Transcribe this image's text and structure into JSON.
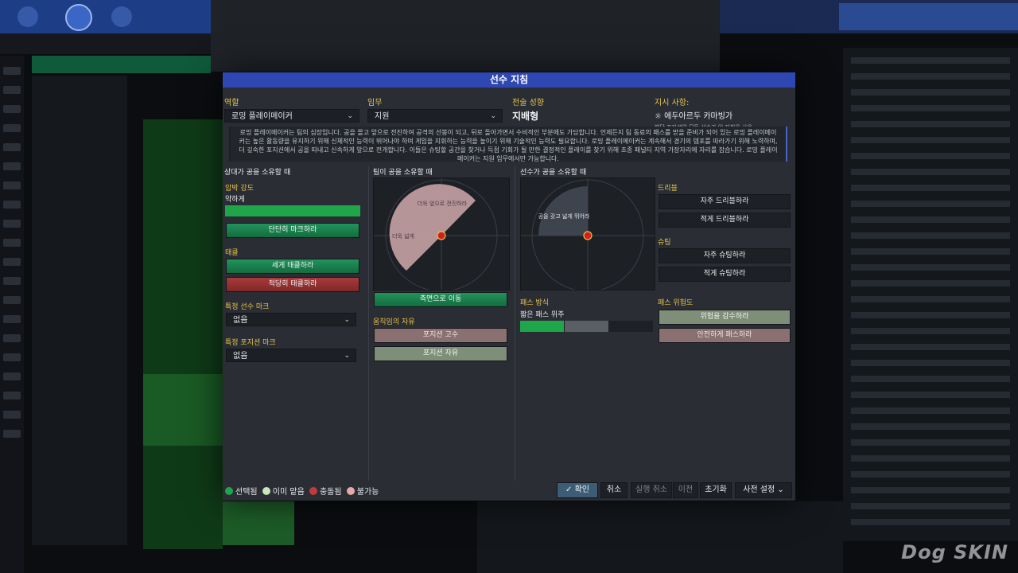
{
  "modal": {
    "title": "선수 지침",
    "fields": {
      "role_label": "역할",
      "role_value": "로밍 플레이메이커",
      "duty_label": "임무",
      "duty_value": "지원",
      "tactic_label": "전술 성향",
      "tactic_value": "지배형",
      "instruction_label": "지시 사항:",
      "instruction_value": "에두아르두 카마빙가",
      "instruction_note": "해당 포지션의 모든 선수가 이 지침을 사용"
    },
    "description": "로밍 플레이메이커는 팀의 심장입니다. 공을 몰고 앞으로 전진하여 공격의 선봉이 되고, 뒤로 돌아가면서 수비적인 부분에도 가담합니다. 언제든지 팀 동료의 패스를 받을 준비가 되어 있는 로밍 플레이메이커는 높은 활동량을 유지하기 위해 신체적인 능력이 뛰어나야 하며 게임을 지휘하는 능력을 높이기 위해 기술적인 능력도 필요합니다. 로밍 플레이메이커는 계속해서 경기의 템포를 따라가기 위해 노력하며, 더 깊숙한 포지션에서 공을 따내고 신속하게 앞으로 전개합니다. 이들은 슈팅할 공간을 찾거나 득점 기회가 될 만한 결정적인 플레이를 찾기 위해 조종 패널티 지역 가장자리에 자리를 잡습니다. 로밍 플레이메이커는 지원 임무에서만 가능합니다.",
    "oppo_ball": {
      "title": "상대가 공을 소유할 때",
      "pressing_label": "압박 강도",
      "pressing_value": "약하게",
      "pressing_level": 1.0,
      "mark_tight": "단단히 마크하라",
      "tackle_label": "태클",
      "tackle_harder": "세게 태클하라",
      "tackle_easy": "적당히 태클하라",
      "specific_player_label": "특정 선수 마크",
      "specific_player_value": "없음",
      "specific_position_label": "특정 포지션 마크",
      "specific_position_value": "없음"
    },
    "team_ball": {
      "title": "팀이 공을 소유할 때",
      "zone_forward": "더욱 앞으로 전진하라",
      "zone_wide": "더욱 넓게",
      "move_wide": "측면으로 이동",
      "freedom_label": "움직임의 자유",
      "hold_position": "포지션 고수",
      "free_role": "포지션 자유"
    },
    "player_ball": {
      "title": "선수가 공을 소유할 때",
      "zone_label": "공을 갖고 넓게 뛰어라",
      "dribble_label": "드리블",
      "dribble_more": "자주 드리블하라",
      "dribble_less": "적게 드리블하라",
      "shoot_label": "슈팅",
      "shoot_more": "자주 슈팅하라",
      "shoot_less": "적게 슈팅하라",
      "passing_style_label": "패스 방식",
      "passing_style_value": "짧은 패스 위주",
      "passing_style_level": 0.33,
      "passing_risk_label": "패스 위험도",
      "risk_more": "위험을 감수하라",
      "risk_less": "안전하게 패스하라"
    },
    "legend": [
      {
        "label": "선택됨",
        "color": "#1fa64a"
      },
      {
        "label": "이미 맡음",
        "color": "#c7e6bd"
      },
      {
        "label": "충돌됨",
        "color": "#c33a3a"
      },
      {
        "label": "불가능",
        "color": "#e8a9a9"
      }
    ],
    "footer": {
      "confirm": "확인",
      "cancel": "취소",
      "undo": "실행 취소",
      "prev": "이전",
      "reset": "초기화",
      "presets": "사전 설정"
    }
  },
  "watermark": "Dog SKIN"
}
